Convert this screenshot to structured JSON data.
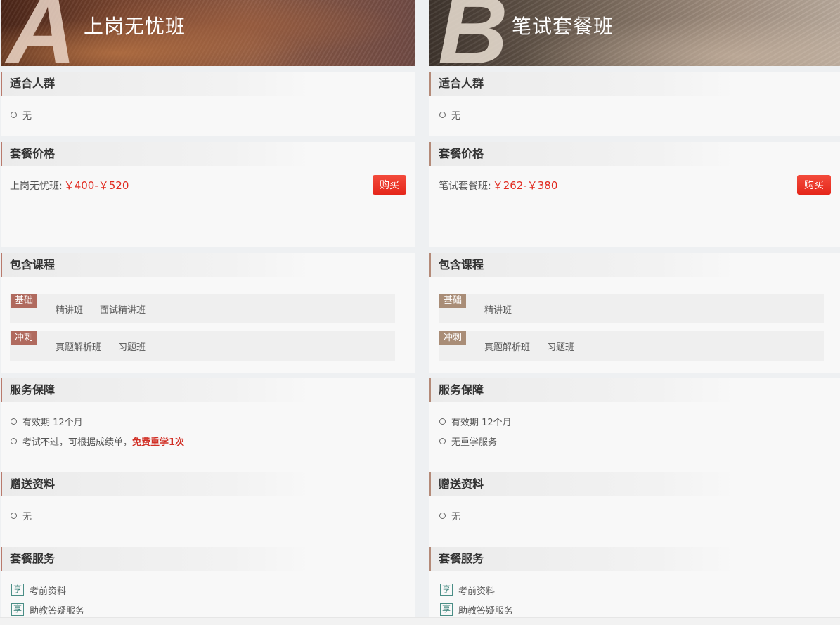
{
  "plans": {
    "a": {
      "letter": "A",
      "title": "上岗无忧班",
      "crowd_heading": "适合人群",
      "crowd_items": [
        "无"
      ],
      "price_heading": "套餐价格",
      "price_label": "上岗无忧班:",
      "price_range": "￥400-￥520",
      "buy_label": "购买",
      "courses_heading": "包含课程",
      "courses": [
        {
          "tag": "基础",
          "items": [
            "精讲班",
            "面试精讲班"
          ]
        },
        {
          "tag": "冲刺",
          "items": [
            "真题解析班",
            "习题班"
          ]
        }
      ],
      "guarantee_heading": "服务保障",
      "guarantee_1": "有效期 12个月",
      "guarantee_2_prefix": "考试不过，可根据成绩单，",
      "guarantee_2_highlight": "免费重学1次",
      "gift_heading": "赠送资料",
      "gift_items": [
        "无"
      ],
      "package_heading": "套餐服务",
      "package_items": [
        {
          "icon": "享",
          "label": "考前资料"
        },
        {
          "icon": "享",
          "label": "助教答疑服务"
        }
      ]
    },
    "b": {
      "letter": "B",
      "title": "笔试套餐班",
      "crowd_heading": "适合人群",
      "crowd_items": [
        "无"
      ],
      "price_heading": "套餐价格",
      "price_label": "笔试套餐班:",
      "price_range": "￥262-￥380",
      "buy_label": "购买",
      "courses_heading": "包含课程",
      "courses": [
        {
          "tag": "基础",
          "items": [
            "精讲班"
          ]
        },
        {
          "tag": "冲刺",
          "items": [
            "真题解析班",
            "习题班"
          ]
        }
      ],
      "guarantee_heading": "服务保障",
      "guarantee_1": "有效期 12个月",
      "guarantee_2": "无重学服务",
      "gift_heading": "赠送资料",
      "gift_items": [
        "无"
      ],
      "package_heading": "套餐服务",
      "package_items": [
        {
          "icon": "享",
          "label": "考前资料"
        },
        {
          "icon": "享",
          "label": "助教答疑服务"
        }
      ]
    }
  },
  "colors": {
    "accent_red": "#e12a1f",
    "tag_a": "#b06a5e",
    "tag_b": "#a98d77",
    "icon_teal": "#4a8e86"
  }
}
